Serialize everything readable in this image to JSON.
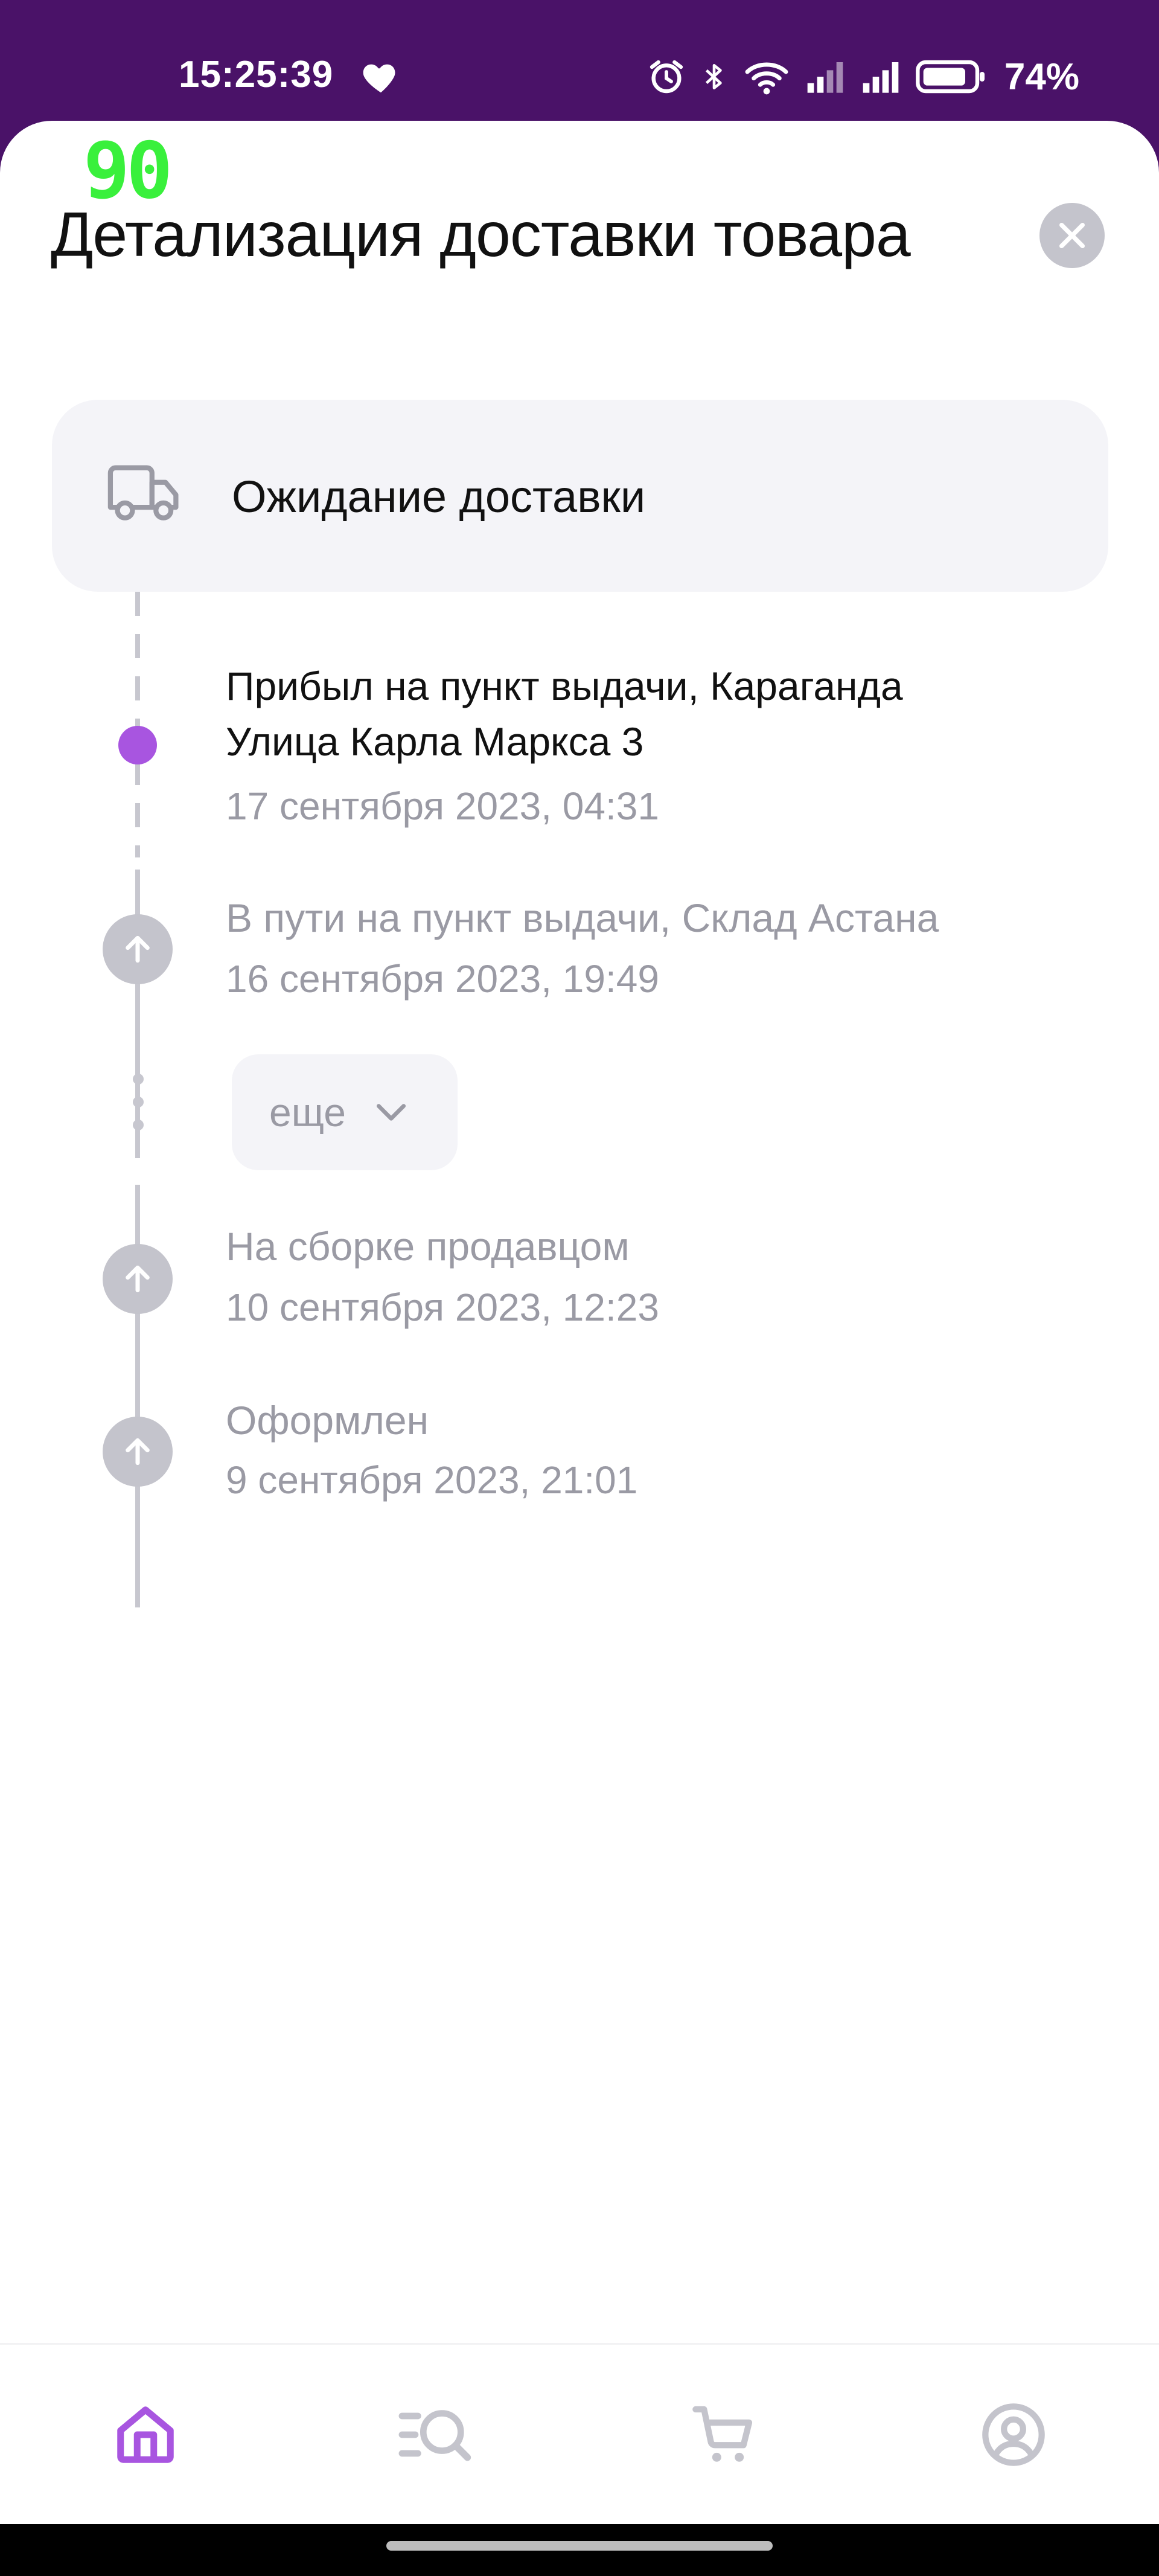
{
  "status_bar": {
    "time": "15:25:39",
    "battery_percent": "74%",
    "icons": [
      "heart-icon",
      "alarm-icon",
      "bluetooth-icon",
      "wifi-icon",
      "signal-icon",
      "signal-icon",
      "battery-icon"
    ]
  },
  "overlay": {
    "fps": "90"
  },
  "sheet": {
    "title": "Детализация доставки товара",
    "close_icon": "close-icon"
  },
  "status_card": {
    "icon": "truck-icon",
    "label": "Ожидание доставки"
  },
  "timeline": {
    "events": [
      {
        "title_line1": "Прибыл на пункт выдачи, Караганда",
        "title_line2": "Улица Карла Маркса 3",
        "date": "17 сентября 2023, 04:31",
        "state": "active"
      },
      {
        "title_line1": "В пути на пункт выдачи, Склад Астана",
        "date": "16 сентября 2023, 19:49",
        "state": "past"
      },
      {
        "title_line1": "На сборке продавцом",
        "date": "10 сентября 2023, 12:23",
        "state": "past"
      },
      {
        "title_line1": "Оформлен",
        "date": "9 сентября 2023, 21:01",
        "state": "past"
      }
    ],
    "more_label": "еще"
  },
  "bottom_nav": {
    "items": [
      {
        "icon": "home-icon",
        "active": true
      },
      {
        "icon": "catalog-search-icon",
        "active": false
      },
      {
        "icon": "cart-icon",
        "active": false
      },
      {
        "icon": "profile-icon",
        "active": false
      }
    ]
  },
  "colors": {
    "status_bar": "#4a1268",
    "accent": "#a855e0",
    "inactive": "#c4c4cc",
    "muted_text": "#9a9aa4",
    "card_bg": "#f4f4f8"
  }
}
